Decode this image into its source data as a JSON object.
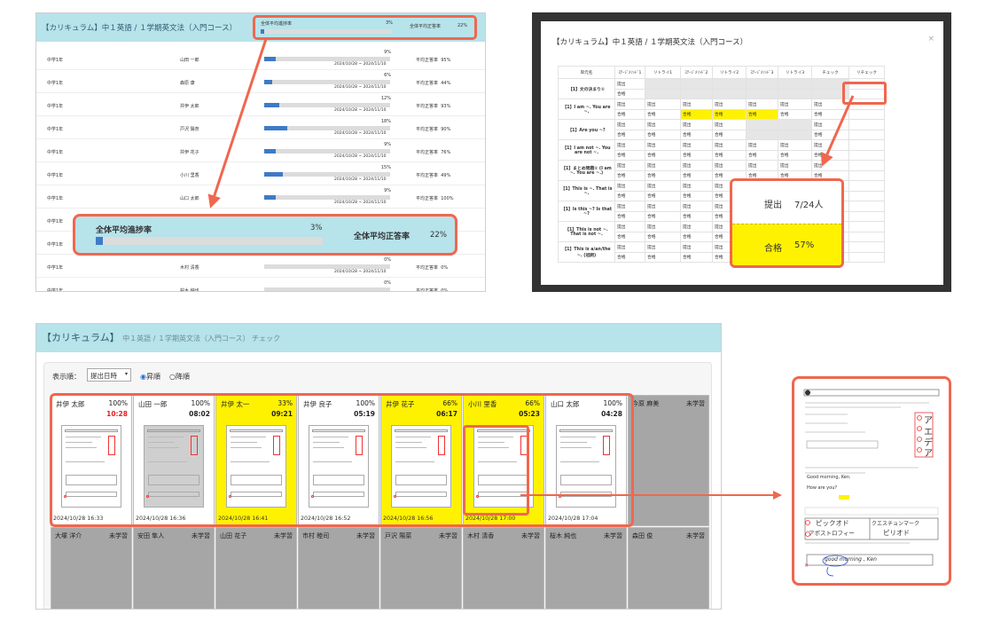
{
  "panel1": {
    "title": "【カリキュラム】中１英語 / １学期英文法（入門コース）",
    "header_progress_label": "全体平均進捗率",
    "header_progress_value": "3%",
    "header_progress_fraction": 0.03,
    "header_accuracy_label": "全体平均正答率",
    "header_accuracy_value": "22%",
    "rows": [
      {
        "grade": "中学1年",
        "name": "山田 一郎",
        "progress": "9%",
        "fill": 0.09,
        "range": "2024/10/28 ~ 2024/11/10",
        "accuracy_label": "平均正答率",
        "accuracy": "95%"
      },
      {
        "grade": "中学1年",
        "name": "森原 康",
        "progress": "6%",
        "fill": 0.06,
        "range": "2024/10/28 ~ 2024/11/10",
        "accuracy_label": "平均正答率",
        "accuracy": "44%"
      },
      {
        "grade": "中学1年",
        "name": "井伊 太郎",
        "progress": "12%",
        "fill": 0.12,
        "range": "2024/10/28 ~ 2024/11/10",
        "accuracy_label": "平均正答率",
        "accuracy": "93%"
      },
      {
        "grade": "中学1年",
        "name": "戸沢 陽奈",
        "progress": "18%",
        "fill": 0.18,
        "range": "2024/10/28 ~ 2024/11/10",
        "accuracy_label": "平均正答率",
        "accuracy": "90%"
      },
      {
        "grade": "中学1年",
        "name": "井伊 花子",
        "progress": "9%",
        "fill": 0.09,
        "range": "2024/10/28 ~ 2024/11/10",
        "accuracy_label": "平均正答率",
        "accuracy": "76%"
      },
      {
        "grade": "中学1年",
        "name": "小川 里香",
        "progress": "15%",
        "fill": 0.15,
        "range": "2024/10/28 ~ 2024/11/10",
        "accuracy_label": "平均正答率",
        "accuracy": "49%"
      },
      {
        "grade": "中学1年",
        "name": "山口 太郎",
        "progress": "9%",
        "fill": 0.09,
        "range": "2024/10/28 ~ 2024/11/10",
        "accuracy_label": "平均正答率",
        "accuracy": "100%"
      },
      {
        "grade": "中学1年",
        "name": "",
        "progress": "",
        "fill": 0.0,
        "range": "",
        "accuracy_label": "",
        "accuracy": ""
      },
      {
        "grade": "中学1年",
        "name": "",
        "progress": "",
        "fill": 0.0,
        "range": "",
        "accuracy_label": "",
        "accuracy": ""
      },
      {
        "grade": "中学1年",
        "name": "木村 清香",
        "progress": "0%",
        "fill": 0.0,
        "range": "2024/10/28 ~ 2024/11/10",
        "accuracy_label": "平均正答率",
        "accuracy": "0%"
      },
      {
        "grade": "中学1年",
        "name": "桜木 純也",
        "progress": "0%",
        "fill": 0.0,
        "range": "",
        "accuracy_label": "平均正答率",
        "accuracy": "0%"
      }
    ],
    "zoom_progress_label": "全体平均進捗率",
    "zoom_progress_value": "3%",
    "zoom_accuracy_label": "全体平均正答率",
    "zoom_accuracy_value": "22%"
  },
  "panel2": {
    "title": "【カリキュラム】中１英語 / １学期英文法（入門コース）",
    "close": "×",
    "headers": [
      "単元名",
      "ｽﾃｰｼﾞﾒｿｯﾄﾞ1",
      "リトライ1",
      "ｽﾃｰｼﾞﾒｿｯﾄﾞ2",
      "リトライ2",
      "ｽﾃｰｼﾞﾒｿｯﾄﾞ3",
      "リトライ3",
      "チェック",
      "リチェック"
    ],
    "units": [
      "【1】文の決まり①",
      "【1】I am ~. You are ~.",
      "【1】Are you ~?",
      "【1】I am not ~. You are not ~.",
      "【1】まとめ問題① (I am ~. You are ~.)",
      "【1】This is ~. That is ~.",
      "【1】Is this ~? Is that ~?",
      "【1】This is not ~. That is not ~.",
      "【1】This is a/an/the ~. (冠詞)"
    ],
    "cell_submit": "提出",
    "cell_pass": "合格",
    "zoom_submit_label": "提出",
    "zoom_submit_value": "7/24人",
    "zoom_pass_label": "合格",
    "zoom_pass_value": "57%"
  },
  "panel3": {
    "title": "【カリキュラム】",
    "subtitle": "中１英語 / １学期英文法（入門コース） チェック",
    "display_order_label": "表示順：",
    "select_value": "提出日時",
    "asc_label": "昇順",
    "desc_label": "降順",
    "cards": [
      {
        "name": "井伊 太郎",
        "pct": "100%",
        "time": "10:28",
        "date": "2024/10/28 16:33",
        "late": true,
        "highlight": false
      },
      {
        "name": "山田 一郎",
        "pct": "100%",
        "time": "08:02",
        "date": "2024/10/28 16:36",
        "late": false,
        "highlight": false
      },
      {
        "name": "井伊 太一",
        "pct": "33%",
        "time": "09:21",
        "date": "2024/10/28 16:41",
        "late": false,
        "highlight": true
      },
      {
        "name": "井伊 良子",
        "pct": "100%",
        "time": "05:19",
        "date": "2024/10/28 16:52",
        "late": false,
        "highlight": false
      },
      {
        "name": "井伊 花子",
        "pct": "66%",
        "time": "06:17",
        "date": "2024/10/28 16:56",
        "late": false,
        "highlight": true
      },
      {
        "name": "小川 里香",
        "pct": "66%",
        "time": "05:23",
        "date": "2024/10/28 17:00",
        "late": false,
        "highlight": true
      },
      {
        "name": "山口 太郎",
        "pct": "100%",
        "time": "04:28",
        "date": "2024/10/28 17:04",
        "late": false,
        "highlight": false
      }
    ],
    "pending_first": {
      "name": "今原 麻美",
      "status": "未学習"
    },
    "pending": [
      {
        "name": "大塚 洋介",
        "status": "未学習"
      },
      {
        "name": "安田 隼人",
        "status": "未学習"
      },
      {
        "name": "山田 花子",
        "status": "未学習"
      },
      {
        "name": "市村 睦司",
        "status": "未学習"
      },
      {
        "name": "戸沢 陽菜",
        "status": "未学習"
      },
      {
        "name": "木村 清香",
        "status": "未学習"
      },
      {
        "name": "桜木 純也",
        "status": "未学習"
      },
      {
        "name": "森田 俊",
        "status": "未学習"
      }
    ]
  },
  "panel4": {
    "hw_1": "ア",
    "hw_2": "エ",
    "hw_3": "デ",
    "hw_4": "ア",
    "line_a": "Good morning, Ken.",
    "line_b": "How are you?",
    "box_left_1": "ピックオド",
    "box_left_2": "アポストロフィー",
    "box_right_1": "クエスチョンマーク",
    "box_right_2": "ピリオド",
    "answer": "good morning , Ken",
    "colors": {
      "accent": "#f0674e",
      "header": "#b7e3ea",
      "highlight": "#fff200",
      "bar": "#3d7bc6"
    }
  }
}
